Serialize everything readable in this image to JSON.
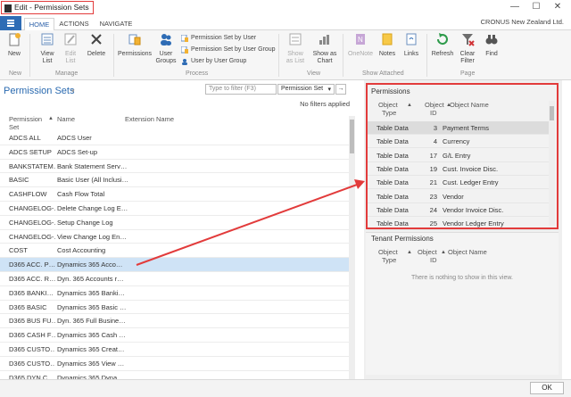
{
  "window": {
    "title": "Edit - Permission Sets",
    "min": "—",
    "max": "☐",
    "close": "✕"
  },
  "tabs": {
    "file": "",
    "home": "HOME",
    "actions": "ACTIONS",
    "navigate": "NAVIGATE"
  },
  "company": "CRONUS New Zealand Ltd.",
  "ribbon": {
    "new": "New",
    "view_list_1": "View",
    "view_list_2": "List",
    "edit_list_1": "Edit",
    "edit_list_2": "List",
    "delete": "Delete",
    "permissions": "Permissions",
    "user_groups_1": "User",
    "user_groups_2": "Groups",
    "perm_by_user": "Permission Set by User",
    "perm_by_group": "Permission Set by User Group",
    "user_by_group": "User by User Group",
    "show_list_1": "Show",
    "show_list_2": "as List",
    "show_chart_1": "Show as",
    "show_chart_2": "Chart",
    "onenote": "OneNote",
    "notes": "Notes",
    "links": "Links",
    "refresh": "Refresh",
    "clear_filter_1": "Clear",
    "clear_filter_2": "Filter",
    "find": "Find",
    "groups": {
      "new": "New",
      "manage": "Manage",
      "process": "Process",
      "view": "View",
      "show_attached": "Show Attached",
      "page": "Page"
    }
  },
  "list": {
    "title": "Permission Sets",
    "filter_placeholder": "Type to filter (F3)",
    "filter_field": "Permission Set",
    "filter_go": "→",
    "no_filters": "No filters applied",
    "col_permission_set_1": "Permission",
    "col_permission_set_2": "Set",
    "col_name": "Name",
    "col_extension": "Extension Name",
    "rows": [
      {
        "set": "ADCS ALL",
        "name": "ADCS User"
      },
      {
        "set": "ADCS SETUP",
        "name": "ADCS Set-up"
      },
      {
        "set": "BANKSTATEM…",
        "name": "Bank Statement Serv…"
      },
      {
        "set": "BASIC",
        "name": "Basic User (All Inclusi…"
      },
      {
        "set": "CASHFLOW",
        "name": "Cash Flow Total"
      },
      {
        "set": "CHANGELOG-…",
        "name": "Delete Change Log E…"
      },
      {
        "set": "CHANGELOG-…",
        "name": "Setup Change Log"
      },
      {
        "set": "CHANGELOG-…",
        "name": "View Change Log En…"
      },
      {
        "set": "COST",
        "name": "Cost Accounting"
      },
      {
        "set": "D365 ACC. P…",
        "name": "Dynamics 365 Acco…"
      },
      {
        "set": "D365 ACC. R…",
        "name": "Dyn. 365 Accounts r…"
      },
      {
        "set": "D365 BANKI…",
        "name": "Dynamics 365 Banki…"
      },
      {
        "set": "D365 BASIC",
        "name": "Dynamics 365 Basic …"
      },
      {
        "set": "D365 BUS FU…",
        "name": "Dyn. 365 Full Busine…"
      },
      {
        "set": "D365 CASH F…",
        "name": "Dynamics 365 Cash …"
      },
      {
        "set": "D365 CUSTO…",
        "name": "Dynamics 365 Creat…"
      },
      {
        "set": "D365 CUSTO…",
        "name": "Dynamics 365 View …"
      },
      {
        "set": "D365 DYN C…",
        "name": "Dynamics 365 Dyna…"
      }
    ]
  },
  "permissions": {
    "title": "Permissions",
    "col_type_1": "Object",
    "col_type_2": "Type",
    "col_id_1": "Object",
    "col_id_2": "ID",
    "col_name": "Object Name",
    "rows": [
      {
        "type": "Table Data",
        "id": "3",
        "name": "Payment Terms"
      },
      {
        "type": "Table Data",
        "id": "4",
        "name": "Currency"
      },
      {
        "type": "Table Data",
        "id": "17",
        "name": "G/L Entry"
      },
      {
        "type": "Table Data",
        "id": "19",
        "name": "Cust. Invoice Disc."
      },
      {
        "type": "Table Data",
        "id": "21",
        "name": "Cust. Ledger Entry"
      },
      {
        "type": "Table Data",
        "id": "23",
        "name": "Vendor"
      },
      {
        "type": "Table Data",
        "id": "24",
        "name": "Vendor Invoice Disc."
      },
      {
        "type": "Table Data",
        "id": "25",
        "name": "Vendor Ledger Entry"
      }
    ]
  },
  "tenant": {
    "title": "Tenant Permissions",
    "col_type_1": "Object",
    "col_type_2": "Type",
    "col_id_1": "Object",
    "col_id_2": "ID",
    "col_name": "Object Name",
    "empty": "There is nothing to show in this view."
  },
  "footer": {
    "ok": "OK"
  },
  "colors": {
    "accent": "#2e6cb5",
    "highlight": "#e23b3b",
    "selected_row": "#cfe3f6"
  }
}
